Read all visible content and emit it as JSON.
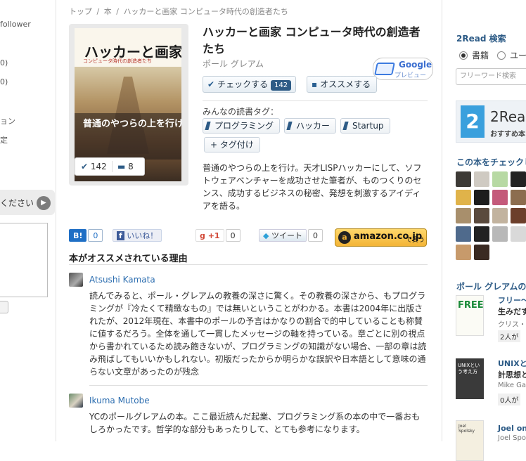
{
  "left": {
    "follower_text": "follower",
    "count1": "0)",
    "count2": "0)",
    "item1": "ョン",
    "item2": "定",
    "box_text": "ください",
    "box_arrow": "▶"
  },
  "breadcrumb": [
    "トップ",
    "/",
    "本",
    "/",
    "ハッカーと画家 コンピュータ時代の創造者たち"
  ],
  "book": {
    "title": "ハッカーと画家 コンピュータ時代の創造者たち",
    "author": "ポール グレアム",
    "cover_title": "ハッカーと画家",
    "cover_subtitle": "コンピュータ時代の創造者たち",
    "cover_band": "普通のやつらの上を行け",
    "cover_check_count": "142",
    "cover_comment_count": "8",
    "description": "普通のやつらの上を行け。天才LISPハッカーにして、ソフトウェアベンチャーを成功させた筆者が、ものつくりのセンス、成功するビジネスの秘密、発想を刺激するアイディアを語る。"
  },
  "google_preview": {
    "brand": "Google",
    "label": "プレビュー"
  },
  "actions": {
    "check_label": "チェックする",
    "check_count": "142",
    "recommend_label": "オススメする"
  },
  "tags": {
    "label": "みんなの読書タグ：",
    "items": [
      "プログラミング",
      "ハッカー",
      "Startup"
    ],
    "add_label": "+ タグ付け"
  },
  "social": {
    "hatena_label": "B!",
    "hatena_count": "0",
    "facebook_label": "いいね！",
    "gplus_label": "+1",
    "gplus_count": "0",
    "tweet_label": "ツイート",
    "tweet_count": "0",
    "amazon_label": "amazon.co.jp",
    "amazon_sub": "で買う"
  },
  "reviews_section_title": "本がオススメされている理由",
  "reviews": [
    {
      "name": "Atsushi Kamata",
      "text": "読んでみると、ポール・グレアムの教養の深さに驚く。その教養の深さから、もプログラミングが『冷たくて精緻なもの』では無いということがわかる。本書は2004年に出版されたが、2012年現在、本書中のポールの予言はかなりの割合で的中していることも称賛に値するだろう。全体を通して一貫したメッセージの軸を持っている。章ごとに別の視点から書かれているため読み飽きないが、プログラミングの知識がない場合、一部の章は読み飛ばしてもいいかもしれない。初版だったからか明らかな誤訳や日本語として意味の通らない文章があったのが残念"
    },
    {
      "name": "Ikuma Mutobe",
      "text": "YCのポールグレアムの本。ここ最近読んだ起業、プログラミング系の本の中で一番おもしろかったです。哲学的な部分もあったりして、とても参考になります。"
    }
  ],
  "right": {
    "search_heading": "2Read 検索",
    "radio_book": "書籍",
    "radio_user": "ユー",
    "search_placeholder": "フリーワード検索",
    "banner_logo": "2",
    "banner_title": "2Rea",
    "banner_sub": "おすすめ本",
    "checkers_heading": "この本をチェックし",
    "author_books_heading": "ポール グレアムの",
    "books": [
      {
        "title1": "フリー～",
        "title2": "生みだす",
        "author": "クリス・",
        "count": "2人が",
        "cover_text": "FREE"
      },
      {
        "title1": "UNIXとい",
        "title2": "計思想と",
        "author": "Mike Gan",
        "count": "0人が",
        "cover_text": "UNIXという考え方"
      },
      {
        "title1": "Joel on",
        "title2": "",
        "author": "Joel Spo",
        "count": "",
        "cover_text": "Joel Spolsky"
      }
    ]
  }
}
